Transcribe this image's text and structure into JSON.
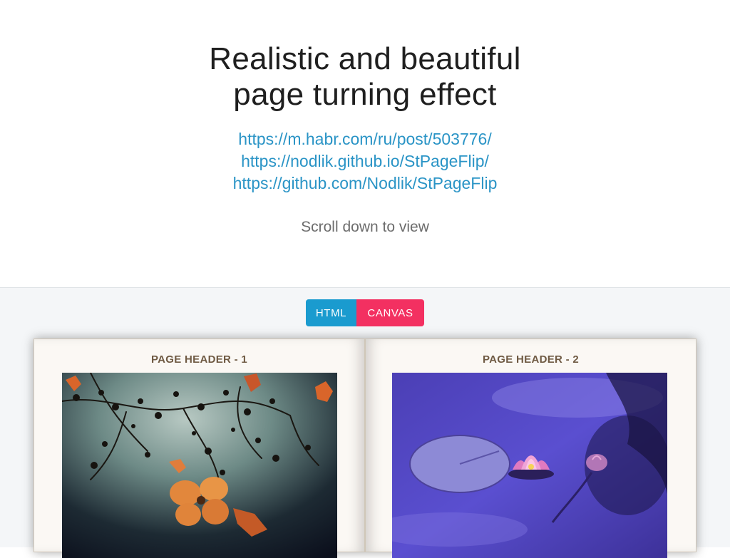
{
  "hero": {
    "title_line1": "Realistic and beautiful",
    "title_line2": "page turning effect",
    "links": [
      "https://m.habr.com/ru/post/503776/",
      "https://nodlik.github.io/StPageFlip/",
      "https://github.com/Nodlik/StPageFlip"
    ],
    "scroll_hint": "Scroll down to view"
  },
  "mode_switch": {
    "html_label": "HTML",
    "canvas_label": "CANVAS"
  },
  "book": {
    "pages": [
      {
        "header": "PAGE HEADER - 1",
        "image": "autumn-flowers-photo"
      },
      {
        "header": "PAGE HEADER - 2",
        "image": "water-lily-photo"
      }
    ]
  },
  "colors": {
    "link": "#2a94c6",
    "html_button": "#1a9bcf",
    "canvas_button": "#f33061",
    "page_header": "#6f5a43",
    "page_bg": "#fbf8f4"
  }
}
